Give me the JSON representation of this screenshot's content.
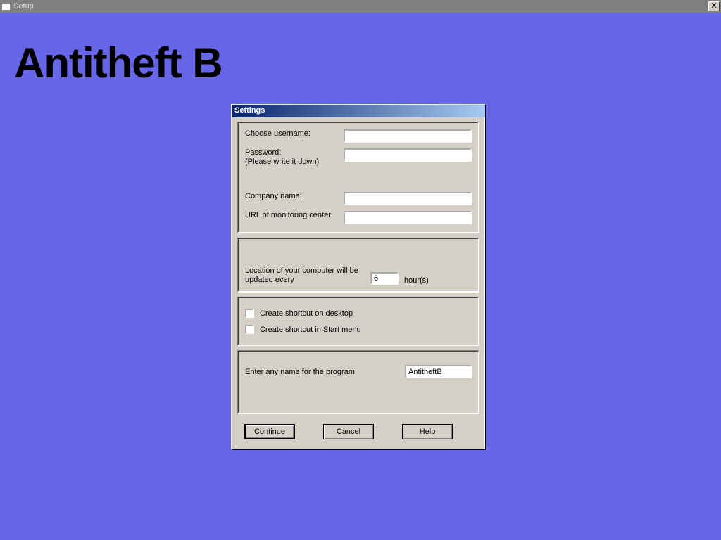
{
  "window": {
    "title": "Setup",
    "close_glyph": "X"
  },
  "app": {
    "headline": "Antitheft B"
  },
  "dialog": {
    "title": "Settings",
    "fields": {
      "username_label": "Choose username:",
      "username_value": "",
      "password_label": "Password:\n(Please write it down)",
      "password_value": "",
      "company_label": "Company name:",
      "company_value": "",
      "url_label": "URL of monitoring center:",
      "url_value": ""
    },
    "interval": {
      "label": "Location of your computer will be updated every",
      "value": "6",
      "unit": "hour(s)"
    },
    "shortcuts": {
      "desktop_label": "Create shortcut on desktop",
      "desktop_checked": false,
      "startmenu_label": "Create shortcut in Start menu",
      "startmenu_checked": false
    },
    "program_name": {
      "label": "Enter any name for the program",
      "value": "AntitheftB"
    },
    "buttons": {
      "continue": "Continue",
      "cancel": "Cancel",
      "help": "Help"
    }
  }
}
